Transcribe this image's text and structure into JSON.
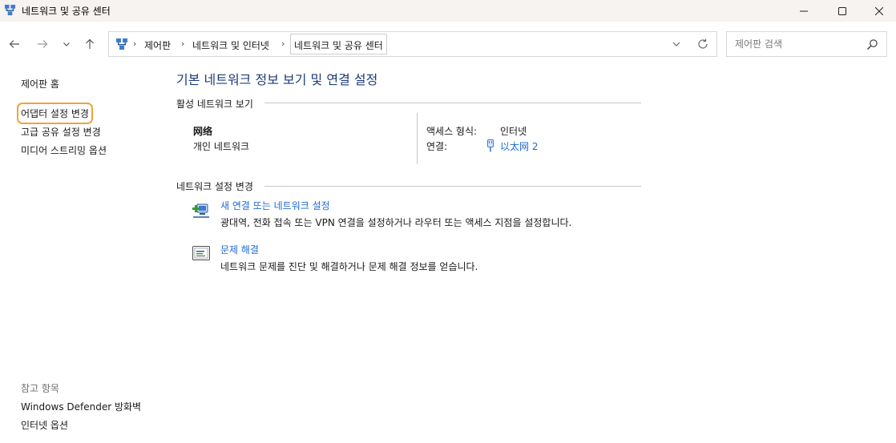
{
  "window": {
    "title": "네트워크 및 공유 센터",
    "minimize_icon": "minimize-icon",
    "maximize_icon": "maximize-icon",
    "close_icon": "close-icon"
  },
  "nav": {
    "back_icon": "back-arrow-icon",
    "forward_icon": "forward-arrow-icon",
    "recent_icon": "chevron-down-icon",
    "up_icon": "up-arrow-icon"
  },
  "address": {
    "crumbs": [
      "제어판",
      "네트워크 및 인터넷",
      "네트워크 및 공유 센터"
    ],
    "separator": "›"
  },
  "search": {
    "placeholder": "제어판 검색"
  },
  "sidebar": {
    "links": [
      "제어판 홈",
      "어댑터 설정 변경",
      "고급 공유 설정 변경",
      "미디어 스트리밍 옵션"
    ],
    "see_also_title": "참고 항목",
    "see_also_links": [
      "Windows Defender 방화벽",
      "인터넷 옵션"
    ]
  },
  "main": {
    "title": "기본 네트워크 정보 보기 및 연결 설정",
    "active_section": "활성 네트워크 보기",
    "network_name": "网络",
    "network_type": "개인 네트워크",
    "access_type_label": "액세스 형식:",
    "access_type_value": "인터넷",
    "connection_label": "연결:",
    "connection_value": "以太网 2",
    "change_section": "네트워크 설정 변경",
    "tasks": [
      {
        "title": "새 연결 또는 네트워크 설정",
        "desc": "광대역, 전화 접속 또는 VPN 연결을 설정하거나 라우터 또는 액세스 지점을 설정합니다."
      },
      {
        "title": "문제 해결",
        "desc": "네트워크 문제를 진단 및 해결하거나 문제 해결 정보를 얻습니다."
      }
    ]
  },
  "colors": {
    "accent_link": "#1d6ad3",
    "title_blue": "#1e3c78",
    "focus_outline": "#f0a33c",
    "titlebar_bg": "#f6f3f1"
  }
}
